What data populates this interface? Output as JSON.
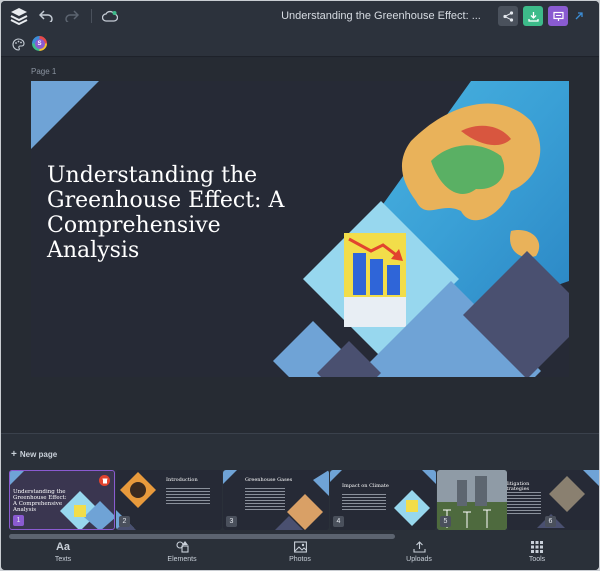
{
  "header": {
    "doc_title": "Understanding the Greenhouse Effect: ...",
    "avatar_letter": "S"
  },
  "page": {
    "label": "Page 1",
    "slide_title": "Understanding the Greenhouse Effect: A Comprehensive Analysis"
  },
  "panel": {
    "new_page_label": "New page",
    "thumbnails": [
      {
        "num": "1",
        "title": "Understanding the Greenhouse Effect: A Comprehensive Analysis"
      },
      {
        "num": "2",
        "title": "Introduction"
      },
      {
        "num": "3",
        "title": "Greenhouse Gases"
      },
      {
        "num": "4",
        "title": "Impact on Climate"
      },
      {
        "num": "5",
        "title": ""
      },
      {
        "num": "6",
        "title": "Mitigation Strategies"
      }
    ]
  },
  "nav": {
    "items": [
      {
        "label": "Texts",
        "icon": "text-icon"
      },
      {
        "label": "Elements",
        "icon": "shapes-icon"
      },
      {
        "label": "Photos",
        "icon": "image-icon"
      },
      {
        "label": "Uploads",
        "icon": "upload-icon"
      },
      {
        "label": "Tools",
        "icon": "grid-icon"
      }
    ]
  },
  "colors": {
    "accent_green": "#3dbb8a",
    "accent_purple": "#8a5bd1",
    "slide_bg": "#262a36",
    "diamond_blue": "#6fa3d6"
  }
}
